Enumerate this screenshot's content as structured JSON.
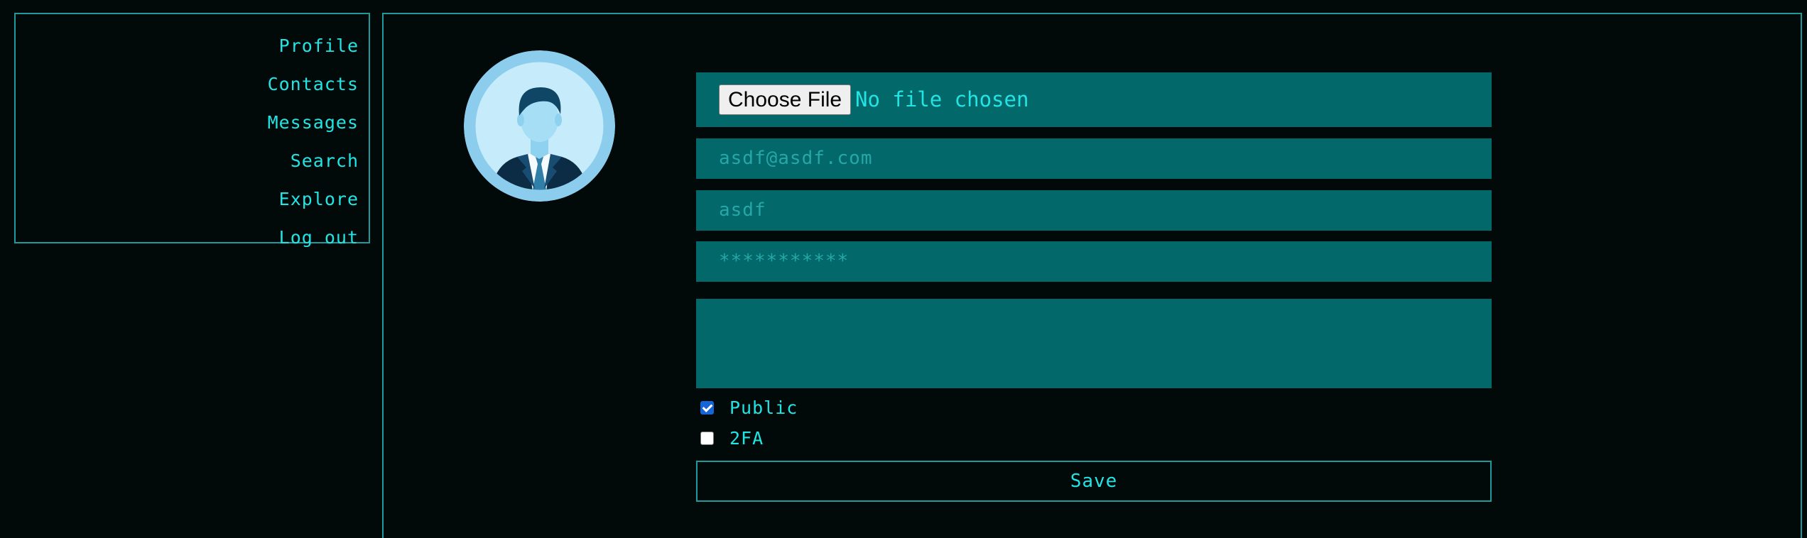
{
  "nav": {
    "items": [
      {
        "label": "Profile"
      },
      {
        "label": "Contacts"
      },
      {
        "label": "Messages"
      },
      {
        "label": "Search"
      },
      {
        "label": "Explore"
      },
      {
        "label": "Log out"
      }
    ]
  },
  "profile_form": {
    "avatar_icon": "user-avatar-businessman",
    "file": {
      "button_label": "Choose File",
      "status": "No file chosen"
    },
    "email": "asdf@asdf.com",
    "username": "asdf",
    "password": "***********",
    "bio": "",
    "public_checkbox": {
      "label": "Public",
      "checked": true
    },
    "twofa_checkbox": {
      "label": "2FA",
      "checked": false
    },
    "save_label": "Save"
  },
  "colors": {
    "background": "#020909",
    "accent": "#22e4e4",
    "border": "#1f9a9c",
    "field_bg": "#03686a"
  }
}
